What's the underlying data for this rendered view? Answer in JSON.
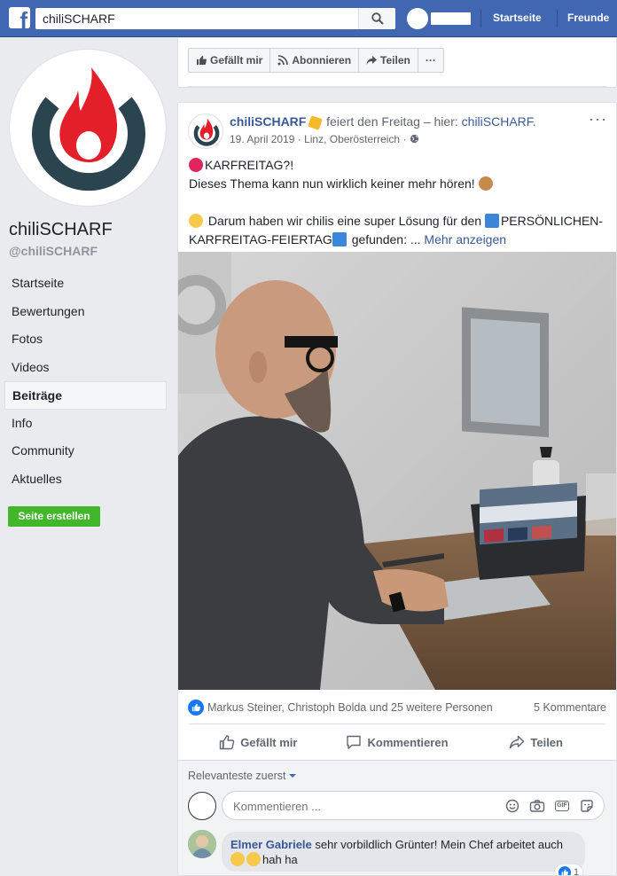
{
  "topbar": {
    "logo": "f",
    "search_value": "chiliSCHARF",
    "search_icon": "search-icon",
    "links": [
      "Startseite",
      "Freunde"
    ]
  },
  "page": {
    "name": "chiliSCHARF",
    "handle": "@chiliSCHARF",
    "brand_colors": {
      "flame": "#e3202a",
      "ring": "#2b4550"
    }
  },
  "nav": {
    "items": [
      "Startseite",
      "Bewertungen",
      "Fotos",
      "Videos",
      "Beiträge",
      "Info",
      "Community",
      "Aktuelles"
    ],
    "active": "Beiträge",
    "create_page": "Seite erstellen"
  },
  "page_actions": {
    "like": "Gefällt mir",
    "follow": "Abonnieren",
    "share": "Teilen",
    "more": "···"
  },
  "post": {
    "author": "chiliSCHARF",
    "activity": "feiert den Freitag – hier:",
    "activity_target": "chiliSCHARF.",
    "date": "19. April 2019",
    "location": "Linz, Oberösterreich",
    "menu": "···",
    "line1": "KARFREITAG?!",
    "line2": "Dieses Thema kann nun wirklich keiner mehr hören!",
    "line3": "Darum haben wir chilis eine super Lösung für den",
    "line4a": "PERSÖNLICHEN-",
    "line4b": "KARFREITAG-FEIERTAG",
    "line4c": "gefunden: ...",
    "see_more": "Mehr anzeigen",
    "reactions_text": "Markus Steiner, Christoph Bolda und 25 weitere Personen",
    "comments_count": "5 Kommentare",
    "btn_like": "Gefällt mir",
    "btn_comment": "Kommentieren",
    "btn_share": "Teilen"
  },
  "comments": {
    "sort_label": "Relevanteste zuerst",
    "input_placeholder": "Kommentieren ...",
    "first": {
      "author": "Elmer Gabriele",
      "text_a": "sehr vorbildlich Grünter! Mein Chef arbeitet auch",
      "text_b": "hah ha",
      "likes": "1"
    }
  }
}
